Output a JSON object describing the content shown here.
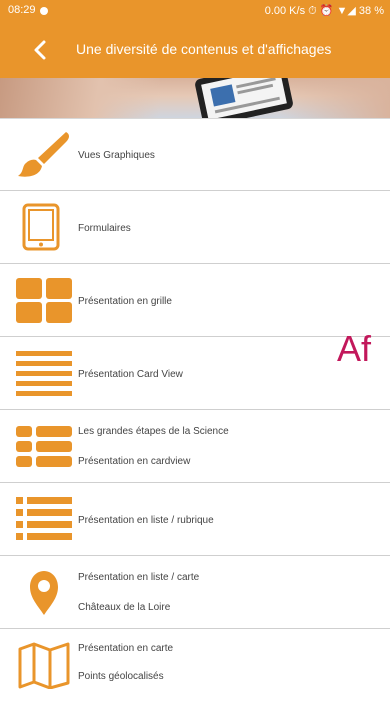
{
  "status": {
    "time": "08:29",
    "info": "0.00 K/s ⏱ ⏰ ▼◢ 38 %"
  },
  "appbar": {
    "title": "Une diversité de contenus et d'affichages"
  },
  "side_text": "Af",
  "items": [
    {
      "icon": "paintbrush-icon",
      "line1": "Vues Graphiques",
      "line2": ""
    },
    {
      "icon": "tablet-icon",
      "line1": "Formulaires",
      "line2": ""
    },
    {
      "icon": "grid-icon",
      "line1": "Présentation en grille",
      "line2": ""
    },
    {
      "icon": "cardview-icon",
      "line1": "Présentation Card View",
      "line2": ""
    },
    {
      "icon": "cardlist-icon",
      "line1": "Les grandes étapes de la Science",
      "line2": "Présentation en cardview"
    },
    {
      "icon": "list-icon",
      "line1": "Présentation en liste / rubrique",
      "line2": ""
    },
    {
      "icon": "map-pin-icon",
      "line1": "Présentation en liste / carte",
      "line2": "Châteaux de la Loire"
    },
    {
      "icon": "map-icon",
      "line1": "Présentation en carte",
      "line2": "Points géolocalisés"
    }
  ],
  "colors": {
    "accent": "#e9952b",
    "text": "#444444",
    "side_text": "#c2185b"
  }
}
